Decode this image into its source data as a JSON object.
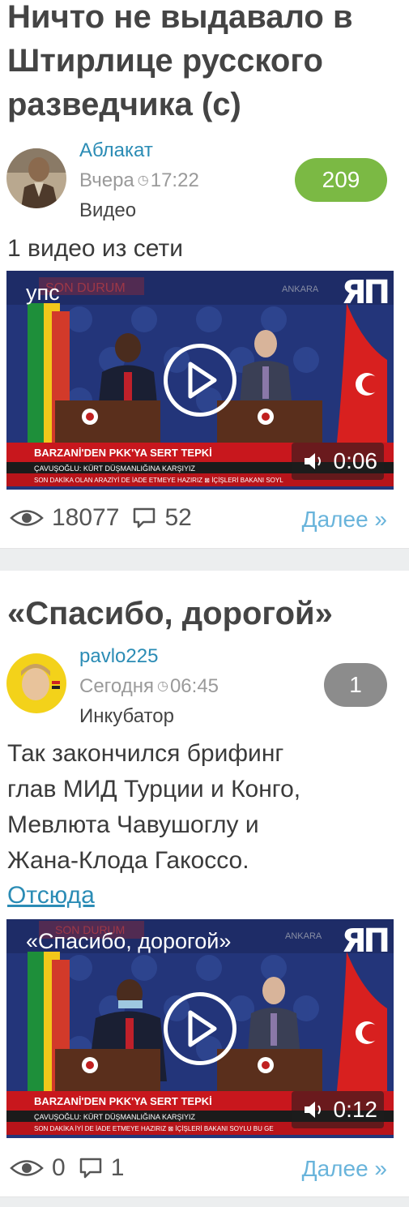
{
  "posts": [
    {
      "title_lines": [
        "Ничто не выдавало в",
        "Штирлице русского",
        "разведчика (с)"
      ],
      "author": "Аблакат",
      "date": "Вчера",
      "time": "17:22",
      "category": "Видео",
      "rating": "209",
      "rating_color": "#7bb944",
      "body": "1 видео из сети",
      "video": {
        "title": "упс",
        "badge": "ЯП",
        "duration": "0:06",
        "ticker_headline": "BARZANİ'DEN PKK'YA SERT TEPKİ",
        "ticker_sub": "ÇAVUŞOĞLU: KÜRT DÜŞMANLIĞINA KARŞIYIZ",
        "ticker_bottom": "SON DAKİKA  OLAN ARAZİYİ DE İADE ETMEYE HAZIRIZ  ⊠  İÇİŞLERİ BAKANI SOYL",
        "top_banner": "SON DURUM",
        "corner_label": "ANKARA"
      },
      "views": "18077",
      "comments": "52",
      "more": "Далее »"
    },
    {
      "title_lines": [
        "«Спасибо, дорогой»"
      ],
      "author": "pavlo225",
      "date": "Сегодня",
      "time": "06:45",
      "category": "Инкубатор",
      "rating": "1",
      "rating_color": "#8c8c8c",
      "body_lines": [
        "Так закончился брифинг",
        "глав МИД Турции и Конго,",
        "Мевлюта Чавушоглу и",
        "Жана-Клода Гакоссо."
      ],
      "source_link": "Отсюда",
      "video": {
        "title": "«Спасибо, дорогой»",
        "badge": "ЯП",
        "duration": "0:12",
        "ticker_headline": "BARZANİ'DEN PKK'YA SERT TEPKİ",
        "ticker_sub": "ÇAVUŞOĞLU: KÜRT DÜŞMANLIĞINA KARŞIYIZ",
        "ticker_bottom": "SON DAKİKA  İYİ DE İADE ETMEYE HAZIRIZ  ⊠  İÇİŞLERİ BAKANI SOYLU  BU GE",
        "top_banner": "SON DURUM",
        "corner_label": "ANKARA"
      },
      "views": "0",
      "comments": "1",
      "more": "Далее »"
    }
  ],
  "icons": {
    "clock": "clock-icon",
    "views": "eye-icon",
    "comments": "comment-icon",
    "sound": "speaker-icon",
    "play": "play-icon"
  }
}
